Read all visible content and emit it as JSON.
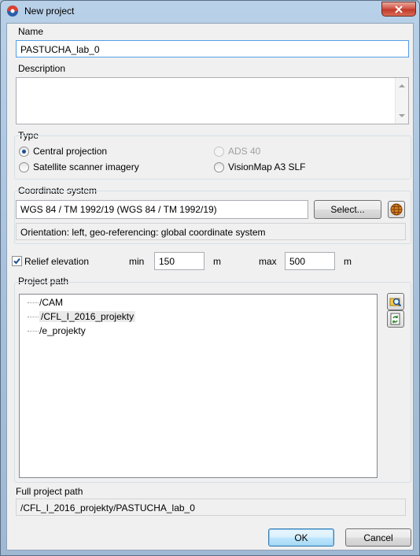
{
  "window": {
    "title": "New project"
  },
  "name": {
    "label": "Name",
    "value": "PASTUCHA_lab_0"
  },
  "description": {
    "label": "Description",
    "value": ""
  },
  "type": {
    "label": "Type",
    "options": [
      {
        "label": "Central projection",
        "checked": true,
        "enabled": true
      },
      {
        "label": "ADS 40",
        "checked": false,
        "enabled": false
      },
      {
        "label": "Satellite scanner imagery",
        "checked": false,
        "enabled": true
      },
      {
        "label": "VisionMap A3 SLF",
        "checked": false,
        "enabled": true
      }
    ]
  },
  "coordinate_system": {
    "label": "Coordinate system",
    "value": "WGS 84 / TM 1992/19 (WGS 84 / TM 1992/19)",
    "select_label": "Select...",
    "orientation": "Orientation: left, geo-referencing: global coordinate system",
    "globe_icon": "globe-icon"
  },
  "relief": {
    "label": "Relief elevation",
    "checked": true,
    "min_label": "min",
    "min_value": "150",
    "min_unit": "m",
    "max_label": "max",
    "max_value": "500",
    "max_unit": "m"
  },
  "project_path": {
    "label": "Project path",
    "items": [
      {
        "label": "/CAM",
        "selected": false
      },
      {
        "label": "/CFL_I_2016_projekty",
        "selected": true
      },
      {
        "label": "/e_projekty",
        "selected": false
      }
    ],
    "browse_icon": "folder-search-icon",
    "refresh_icon": "refresh-icon"
  },
  "full_path": {
    "label": "Full project path",
    "value": "/CFL_I_2016_projekty/PASTUCHA_lab_0"
  },
  "buttons": {
    "ok": "OK",
    "cancel": "Cancel"
  },
  "colors": {
    "accent": "#3c7fb1",
    "close": "#c23a2b"
  }
}
